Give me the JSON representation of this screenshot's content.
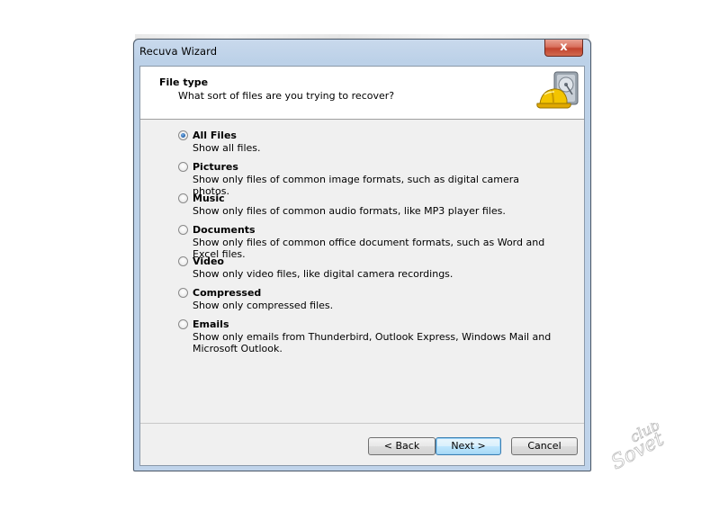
{
  "window": {
    "title": "Recuva Wizard",
    "close_label": "x"
  },
  "header": {
    "title": "File type",
    "subtitle": "What sort of files are you trying to recover?",
    "logo_icon": "recuva-hardhat-drive-icon"
  },
  "options": [
    {
      "label": "All Files",
      "desc": "Show all files.",
      "checked": true
    },
    {
      "label": "Pictures",
      "desc": "Show only files of common image formats, such as digital camera photos.",
      "checked": false
    },
    {
      "label": "Music",
      "desc": "Show only files of common audio formats, like MP3 player files.",
      "checked": false
    },
    {
      "label": "Documents",
      "desc": "Show only files of common office document formats, such as Word and Excel files.",
      "checked": false
    },
    {
      "label": "Video",
      "desc": "Show only video files, like digital camera recordings.",
      "checked": false
    },
    {
      "label": "Compressed",
      "desc": "Show only compressed files.",
      "checked": false
    },
    {
      "label": "Emails",
      "desc": "Show only emails from Thunderbird, Outlook Express, Windows Mail and Microsoft Outlook.",
      "checked": false
    }
  ],
  "buttons": {
    "back": "< Back",
    "next": "Next >",
    "cancel": "Cancel"
  },
  "watermark": {
    "top": "club",
    "bottom": "Sovet"
  },
  "colors": {
    "frame": "#bfd3ea",
    "close": "#c2432e",
    "radio_selected": "#1f5fa8",
    "default_button": "#3c7fb1"
  }
}
